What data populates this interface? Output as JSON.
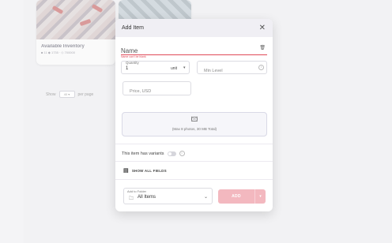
{
  "background": {
    "card1": {
      "title": "Available Inventory",
      "meta": "■ 11  ◆ 1735  ·  ◇ 700000"
    },
    "card2": {
      "title": "",
      "meta": ""
    },
    "pager": {
      "show_label": "Show",
      "per_page_value": "40",
      "per_page_label": "per page"
    }
  },
  "modal": {
    "title": "Add Item",
    "close_icon": "close-icon",
    "name": {
      "placeholder": "Name",
      "value": "",
      "error": "Name can't be blank"
    },
    "quantity": {
      "label": "Quantity",
      "value": "1",
      "unit": "unit"
    },
    "min_level": {
      "placeholder": "Min Level"
    },
    "price": {
      "placeholder": "Price, USD"
    },
    "upload": {
      "hint": "(Max 8 photos, 30 MB Total)",
      "icon": "image-add-icon"
    },
    "variants": {
      "label": "This item has variants",
      "enabled": false
    },
    "show_all_fields": {
      "label": "SHOW ALL FIELDS",
      "icon": "fields-icon"
    },
    "folder": {
      "label": "Add to Folder",
      "value": "All Items"
    },
    "add_button": {
      "label": "ADD",
      "color": "#f3b8bf"
    }
  },
  "colors": {
    "error": "#e04a58",
    "accent": "#f3b8bf"
  }
}
